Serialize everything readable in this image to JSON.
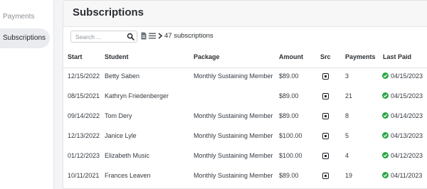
{
  "sidebar": {
    "items": [
      {
        "label": "Payments",
        "active": false
      },
      {
        "label": "Subscriptions",
        "active": true
      }
    ]
  },
  "page": {
    "title": "Subscriptions",
    "search_placeholder": "Search ...",
    "count_label": "47 subscriptions"
  },
  "table": {
    "columns": [
      "Start",
      "Student",
      "Package",
      "Amount",
      "Src",
      "Payments",
      "Last Paid"
    ],
    "rows": [
      {
        "start": "12/15/2022",
        "student": "Betty Saben",
        "package": "Monthly Sustaining Member",
        "amount": "$89.00",
        "src": "square-icon",
        "payments": "3",
        "last_paid": "04/15/2023"
      },
      {
        "start": "08/15/2021",
        "student": "Kathryn Friedenberger",
        "package": "",
        "amount": "$89.00",
        "src": "square-icon",
        "payments": "21",
        "last_paid": "04/15/2023"
      },
      {
        "start": "09/14/2022",
        "student": "Tom Dery",
        "package": "Monthly Sustaining Member",
        "amount": "$89.00",
        "src": "square-icon",
        "payments": "8",
        "last_paid": "04/14/2023"
      },
      {
        "start": "12/13/2022",
        "student": "Janice Lyle",
        "package": "Monthly Sustaining Member",
        "amount": "$100.00",
        "src": "square-icon",
        "payments": "5",
        "last_paid": "04/13/2023"
      },
      {
        "start": "01/12/2023",
        "student": "Elizabeth Music",
        "package": "Monthly Sustaining Member",
        "amount": "$100.00",
        "src": "square-icon",
        "payments": "4",
        "last_paid": "04/12/2023"
      },
      {
        "start": "10/11/2021",
        "student": "Frances Leaven",
        "package": "Monthly Sustaining Member",
        "amount": "$89.00",
        "src": "square-icon",
        "payments": "19",
        "last_paid": "04/11/2023"
      }
    ]
  },
  "colors": {
    "success": "#28a745",
    "active_nav": "#e9ebef"
  }
}
